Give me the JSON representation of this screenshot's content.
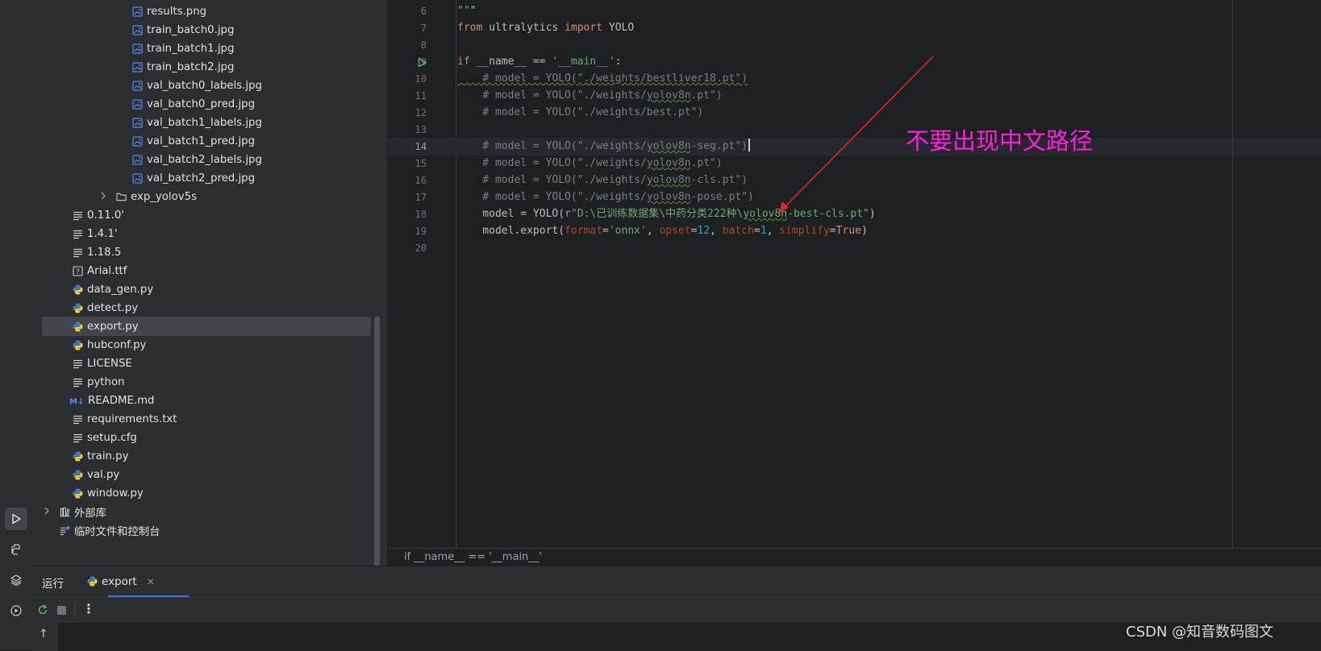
{
  "colors": {
    "accent": "#3574f0",
    "annotation": "#ff1fdc",
    "background": "#1e1f22",
    "panel": "#2b2d30"
  },
  "project_tree": {
    "items": [
      {
        "label": "results.png",
        "icon": "image-file-icon",
        "indent": 2
      },
      {
        "label": "train_batch0.jpg",
        "icon": "image-file-icon",
        "indent": 2
      },
      {
        "label": "train_batch1.jpg",
        "icon": "image-file-icon",
        "indent": 2
      },
      {
        "label": "train_batch2.jpg",
        "icon": "image-file-icon",
        "indent": 2
      },
      {
        "label": "val_batch0_labels.jpg",
        "icon": "image-file-icon",
        "indent": 2
      },
      {
        "label": "val_batch0_pred.jpg",
        "icon": "image-file-icon",
        "indent": 2
      },
      {
        "label": "val_batch1_labels.jpg",
        "icon": "image-file-icon",
        "indent": 2
      },
      {
        "label": "val_batch1_pred.jpg",
        "icon": "image-file-icon",
        "indent": 2
      },
      {
        "label": "val_batch2_labels.jpg",
        "icon": "image-file-icon",
        "indent": 2
      },
      {
        "label": "val_batch2_pred.jpg",
        "icon": "image-file-icon",
        "indent": 2
      },
      {
        "label": "exp_yolov5s",
        "icon": "folder-icon",
        "indent": 1,
        "chevron": true
      },
      {
        "label": "0.11.0'",
        "icon": "text-file-icon",
        "indent": 0
      },
      {
        "label": "1.4.1'",
        "icon": "text-file-icon",
        "indent": 0
      },
      {
        "label": "1.18.5",
        "icon": "text-file-icon",
        "indent": 0
      },
      {
        "label": "Arial.ttf",
        "icon": "unknown-file-icon",
        "indent": 0
      },
      {
        "label": "data_gen.py",
        "icon": "python-file-icon",
        "indent": 0
      },
      {
        "label": "detect.py",
        "icon": "python-file-icon",
        "indent": 0
      },
      {
        "label": "export.py",
        "icon": "python-file-icon",
        "indent": 0,
        "selected": true
      },
      {
        "label": "hubconf.py",
        "icon": "python-file-icon",
        "indent": 0
      },
      {
        "label": "LICENSE",
        "icon": "text-file-icon",
        "indent": 0
      },
      {
        "label": "python",
        "icon": "text-file-icon",
        "indent": 0
      },
      {
        "label": "README.md",
        "icon": "markdown-file-icon",
        "indent": 0
      },
      {
        "label": "requirements.txt",
        "icon": "text-file-icon",
        "indent": 0
      },
      {
        "label": "setup.cfg",
        "icon": "text-file-icon",
        "indent": 0
      },
      {
        "label": "train.py",
        "icon": "python-file-icon",
        "indent": 0
      },
      {
        "label": "val.py",
        "icon": "python-file-icon",
        "indent": 0
      },
      {
        "label": "window.py",
        "icon": "python-file-icon",
        "indent": 0
      },
      {
        "label": "外部库",
        "icon": "library-icon",
        "indent": -1,
        "chevron": true
      },
      {
        "label": "临时文件和控制台",
        "icon": "scratches-icon",
        "indent": -1
      }
    ]
  },
  "editor": {
    "current_line": 14,
    "lines": [
      {
        "n": "6",
        "code": "\"\"\""
      },
      {
        "n": "7",
        "code": "from ultralytics import YOLO"
      },
      {
        "n": "8",
        "code": ""
      },
      {
        "n": "9",
        "code": "if __name__ == '__main__':"
      },
      {
        "n": "10",
        "code": "    # model = YOLO(\"./weights/bestliver18.pt\")"
      },
      {
        "n": "11",
        "code": "    # model = YOLO(\"./weights/yolov8n.pt\")"
      },
      {
        "n": "12",
        "code": "    # model = YOLO(\"./weights/best.pt\")"
      },
      {
        "n": "13",
        "code": ""
      },
      {
        "n": "14",
        "code": "    # model = YOLO(\"./weights/yolov8n-seg.pt\")"
      },
      {
        "n": "15",
        "code": "    # model = YOLO(\"./weights/yolov8n.pt\")"
      },
      {
        "n": "16",
        "code": "    # model = YOLO(\"./weights/yolov8n-cls.pt\")"
      },
      {
        "n": "17",
        "code": "    # model = YOLO(\"./weights/yolov8n-pose.pt\")"
      },
      {
        "n": "18",
        "code": "    model = YOLO(r\"D:\\已训练数据集\\中药分类222种\\yolov8n-best-cls.pt\")"
      },
      {
        "n": "19",
        "code": "    model.export(format='onnx', opset=12, batch=1, simplify=True)"
      },
      {
        "n": "20",
        "code": ""
      }
    ],
    "annotation_text": "不要出现中文路径",
    "breadcrumb": "if __name__ == '__main__'"
  },
  "run_panel": {
    "title": "运行",
    "tab_label": "export",
    "tab_icon": "python-file-icon"
  },
  "watermark": "CSDN @知音数码图文"
}
